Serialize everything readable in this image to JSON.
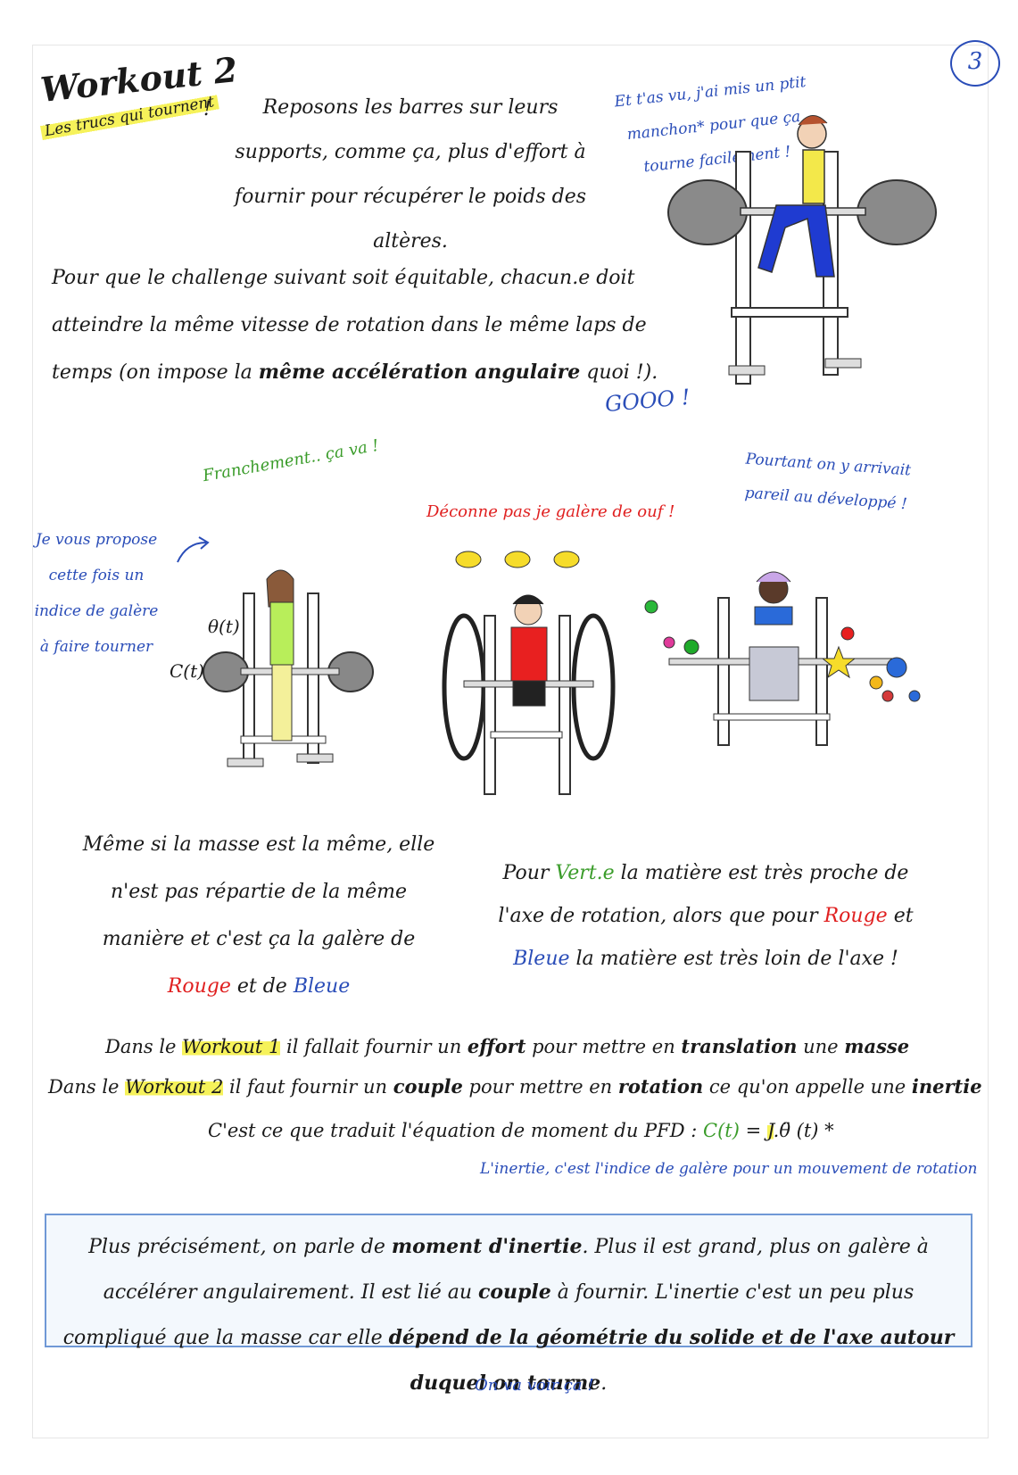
{
  "page_number": "3",
  "title": "Workout 2",
  "subtitle": "Les trucs qui tournent",
  "subtitle_punct": "!",
  "intro": "Reposons les barres sur leurs supports, comme ça, plus d'effort à fournir pour récupérer le poids des altères.",
  "note_top": "Et t'as vu, j'ai mis un ptit manchon* pour que ça tourne facilement !",
  "challenge_pre": "Pour que le challenge suivant soit équitable, chacun.e doit atteindre la même vitesse de rotation dans le même laps de temps (on impose la ",
  "challenge_bold": "même accélération angulaire",
  "challenge_post": " quoi !).",
  "gooo": "GOOO !",
  "green_remark": "Franchement.. ça va !",
  "red_remark": "Déconne pas je galère de ouf !",
  "blue_remark": "Pourtant on y arrivait pareil au développé !",
  "side_note": "Je vous propose cette fois un indice de galère à faire tourner",
  "fig_labels": {
    "theta": "θ(t)",
    "couple": "C(t)"
  },
  "para_left": {
    "text": "Même si la masse est la même, elle n'est pas répartie de la même manière et c'est ça la galère de ",
    "rouge": "Rouge",
    "et_de": " et de ",
    "bleue": "Bleue"
  },
  "para_right": {
    "pour": "Pour ",
    "verte": "Vert.e",
    "mid1": " la matière est très proche de l'axe de rotation, alors que pour ",
    "rouge": "Rouge",
    "et": " et ",
    "bleue": "Bleue",
    "end": " la matière est très loin de l'axe !"
  },
  "line1": {
    "a": "Dans le ",
    "w": "Workout 1",
    "b": " il fallait fournir un ",
    "effort": "effort",
    "c": " pour mettre en ",
    "translation": "translation",
    "d": " une ",
    "masse": "masse"
  },
  "line2": {
    "a": "Dans le ",
    "w": "Workout 2",
    "b": " il faut fournir un ",
    "couple": "couple",
    "c": " pour mettre en ",
    "rotation": "rotation",
    "d": " ce qu'on appelle une ",
    "inertie": "inertie"
  },
  "line3": {
    "text": "C'est ce que traduit l'équation de moment du PFD :",
    "eq_c": "C(t)",
    "eq_eq": " = ",
    "eq_j": "J",
    "eq_rest": ".θ̈ (t) *"
  },
  "line4": "L'inertie, c'est l'indice de galère pour un mouvement de rotation",
  "box": {
    "a": "Plus précisément, on parle de ",
    "moment": "moment d'inertie",
    "b": ". Plus il est grand, plus on galère à accélérer angulairement. Il est lié au ",
    "couple": "couple",
    "c": " à fournir. L'inertie c'est un peu plus compliqué que la masse car elle ",
    "dep": "dépend de la géométrie du solide et de l'axe autour duquel on tourne",
    "d": "."
  },
  "footer": "On va voir ça !"
}
